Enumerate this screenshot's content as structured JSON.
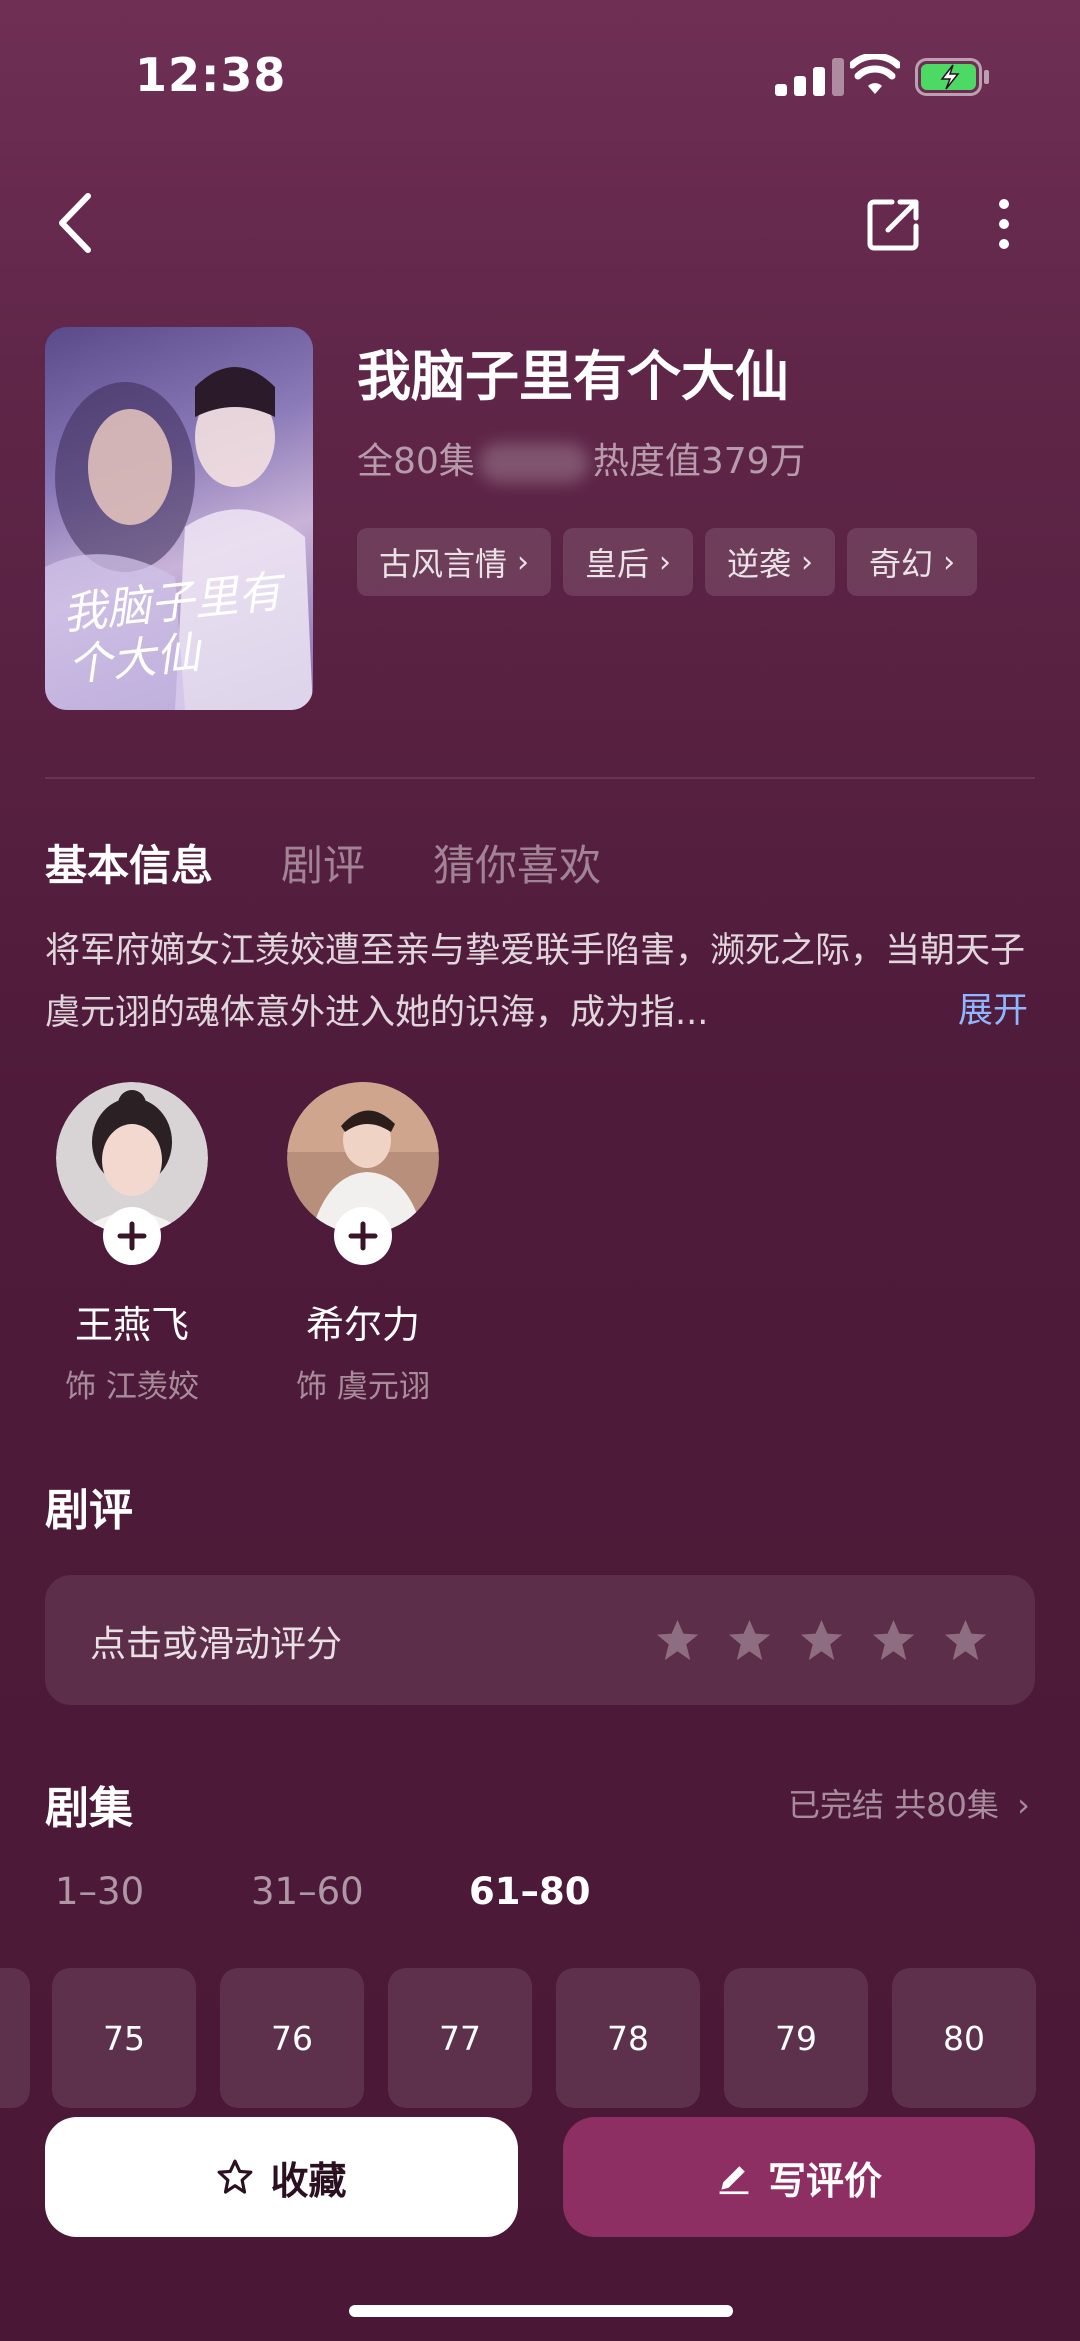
{
  "status_bar": {
    "time": "12:38"
  },
  "drama": {
    "title": "我脑子里有个大仙",
    "episodes_text": "全80集",
    "heat_text": "热度值379万",
    "tags": [
      "古风言情",
      "皇后",
      "逆袭",
      "奇幻"
    ],
    "poster_title": "我脑子里有个大仙"
  },
  "tabs": [
    "基本信息",
    "剧评",
    "猜你喜欢"
  ],
  "synopsis": {
    "text": "将军府嫡女江羡姣遭至亲与挚爱联手陷害，濒死之际，当朝天子虞元诩的魂体意外进入她的识海，成为指...",
    "expand_label": "展开"
  },
  "cast": [
    {
      "name": "王燕飞",
      "role": "饰 江羡姣"
    },
    {
      "name": "希尔力",
      "role": "饰 虞元诩"
    }
  ],
  "review": {
    "heading": "剧评",
    "rate_prompt": "点击或滑动评分",
    "stars": 5
  },
  "episodes": {
    "heading": "剧集",
    "status": "已完结 共80集",
    "ranges": [
      "1–30",
      "31–60",
      "61–80"
    ],
    "active_range": "61–80",
    "items": [
      "75",
      "76",
      "77",
      "78",
      "79",
      "80"
    ]
  },
  "actions": {
    "favorite_label": "收藏",
    "write_review_label": "写评价"
  },
  "colors": {
    "accent": "#8e2f63",
    "link": "#8fb7ff",
    "background": "#5e2547"
  }
}
